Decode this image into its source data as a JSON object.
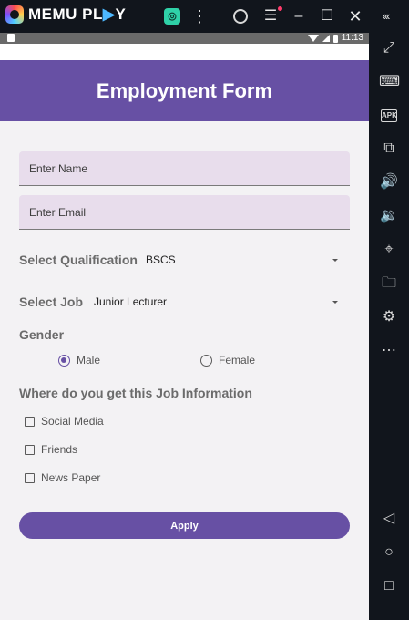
{
  "emulator": {
    "brand_left": "MEMU PL",
    "brand_accent": "▶",
    "brand_right": "Y",
    "status_time": "11:13",
    "icons": [
      "app-store-icon",
      "more-vert-icon",
      "user-icon",
      "menu-icon",
      "minimize-icon",
      "maximize-icon",
      "close-icon",
      "collapse-icon"
    ],
    "side_icons": [
      "fullscreen-icon",
      "keyboard-icon",
      "apk-icon",
      "multi-window-icon",
      "volume-up-icon",
      "volume-down-icon",
      "location-icon",
      "folder-icon",
      "settings-icon",
      "more-horiz-icon",
      "back-icon",
      "home-icon",
      "recents-icon"
    ],
    "apk_label": "APK"
  },
  "form": {
    "title": "Employment Form",
    "name_placeholder": "Enter Name",
    "email_placeholder": "Enter Email",
    "qualification_label": "Select Qualification",
    "qualification_value": "BSCS",
    "job_label": "Select Job",
    "job_value": "Junior Lecturer",
    "gender_label": "Gender",
    "gender_options": [
      "Male",
      "Female"
    ],
    "gender_selected": "Male",
    "info_label": "Where do you get this Job Information",
    "info_options": [
      "Social Media",
      "Friends",
      "News Paper"
    ],
    "apply_label": "Apply"
  },
  "colors": {
    "primary": "#6750a4",
    "field_bg": "#e8ddec",
    "emulator_bg": "#11151c"
  }
}
